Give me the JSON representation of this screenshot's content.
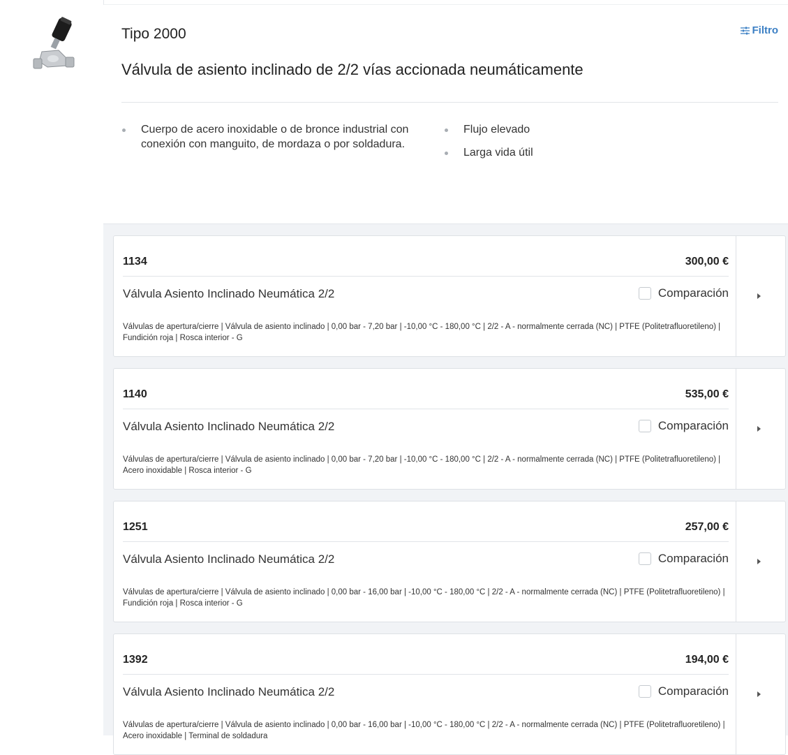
{
  "header": {
    "type_title": "Tipo 2000",
    "filter_label": "Filtro",
    "filter_icon": "sliders-icon",
    "description": "Válvula de asiento inclinado de 2/2 vías accionada neumáticamente",
    "features_left": [
      "Cuerpo de acero inoxidable o de bronce industrial con conexión con manguito, de mordaza o por soldadura."
    ],
    "features_right": [
      "Flujo elevado",
      "Larga vida útil"
    ]
  },
  "thumbnail": {
    "icon": "valve-product-image"
  },
  "compare_label": "Comparación",
  "products": [
    {
      "code": "1134",
      "price": "300,00 €",
      "name": "Válvula Asiento Inclinado Neumática 2/2",
      "specs": "Válvulas de apertura/cierre | Válvula de asiento inclinado | 0,00 bar - 7,20 bar | -10,00 °C - 180,00 °C | 2/2 - A - normalmente cerrada (NC) | PTFE (Politetrafluoretileno) | Fundición roja | Rosca interior - G"
    },
    {
      "code": "1140",
      "price": "535,00 €",
      "name": "Válvula Asiento Inclinado Neumática 2/2",
      "specs": "Válvulas de apertura/cierre | Válvula de asiento inclinado | 0,00 bar - 7,20 bar | -10,00 °C - 180,00 °C | 2/2 - A - normalmente cerrada (NC) | PTFE (Politetrafluoretileno) | Acero inoxidable | Rosca interior - G"
    },
    {
      "code": "1251",
      "price": "257,00 €",
      "name": "Válvula Asiento Inclinado Neumática 2/2",
      "specs": "Válvulas de apertura/cierre | Válvula de asiento inclinado | 0,00 bar - 16,00 bar | -10,00 °C - 180,00 °C | 2/2 - A - normalmente cerrada (NC) | PTFE (Politetrafluoretileno) | Fundición roja | Rosca interior - G"
    },
    {
      "code": "1392",
      "price": "194,00 €",
      "name": "Válvula Asiento Inclinado Neumática 2/2",
      "specs": "Válvulas de apertura/cierre | Válvula de asiento inclinado | 0,00 bar - 16,00 bar | -10,00 °C - 180,00 °C | 2/2 - A - normalmente cerrada (NC) | PTFE (Politetrafluoretileno) | Acero inoxidable | Terminal de soldadura"
    }
  ]
}
